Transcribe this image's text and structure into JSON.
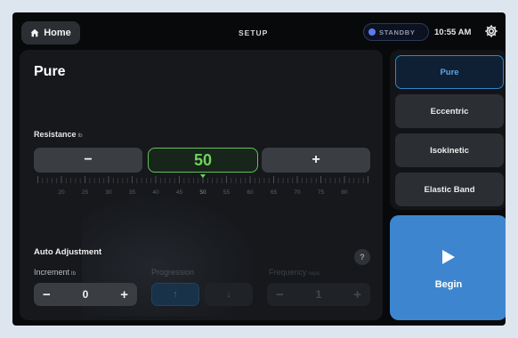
{
  "header": {
    "home_label": "Home",
    "title": "SETUP",
    "status": "STANDBY",
    "time": "10:55 AM"
  },
  "mode": {
    "title": "Pure",
    "options": [
      "Pure",
      "Eccentric",
      "Isokinetic",
      "Elastic Band"
    ],
    "selected": "Pure"
  },
  "resistance": {
    "label": "Resistance",
    "unit": "lb",
    "value": "50",
    "decrement": "−",
    "increment": "+",
    "scale_ticks": [
      "20",
      "25",
      "30",
      "35",
      "40",
      "45",
      "50",
      "55",
      "60",
      "65",
      "70",
      "75",
      "80"
    ]
  },
  "auto_adjustment": {
    "title": "Auto Adjustment",
    "help": "?",
    "increment": {
      "label": "Increment",
      "unit": "lb",
      "value": "0",
      "minus": "−",
      "plus": "+"
    },
    "progression": {
      "label": "Progression",
      "up": "↑",
      "down": "↓"
    },
    "frequency": {
      "label": "Frequency",
      "unit": "reps",
      "value": "1",
      "minus": "−",
      "plus": "+"
    }
  },
  "begin": {
    "label": "Begin"
  },
  "icons": [
    "home-icon",
    "gear-icon",
    "play-icon",
    "arrow-up-icon",
    "arrow-down-icon"
  ],
  "colors": {
    "accent_green": "#6fd35f",
    "accent_blue": "#3d86cf",
    "status_dot": "#5b7cf0"
  }
}
